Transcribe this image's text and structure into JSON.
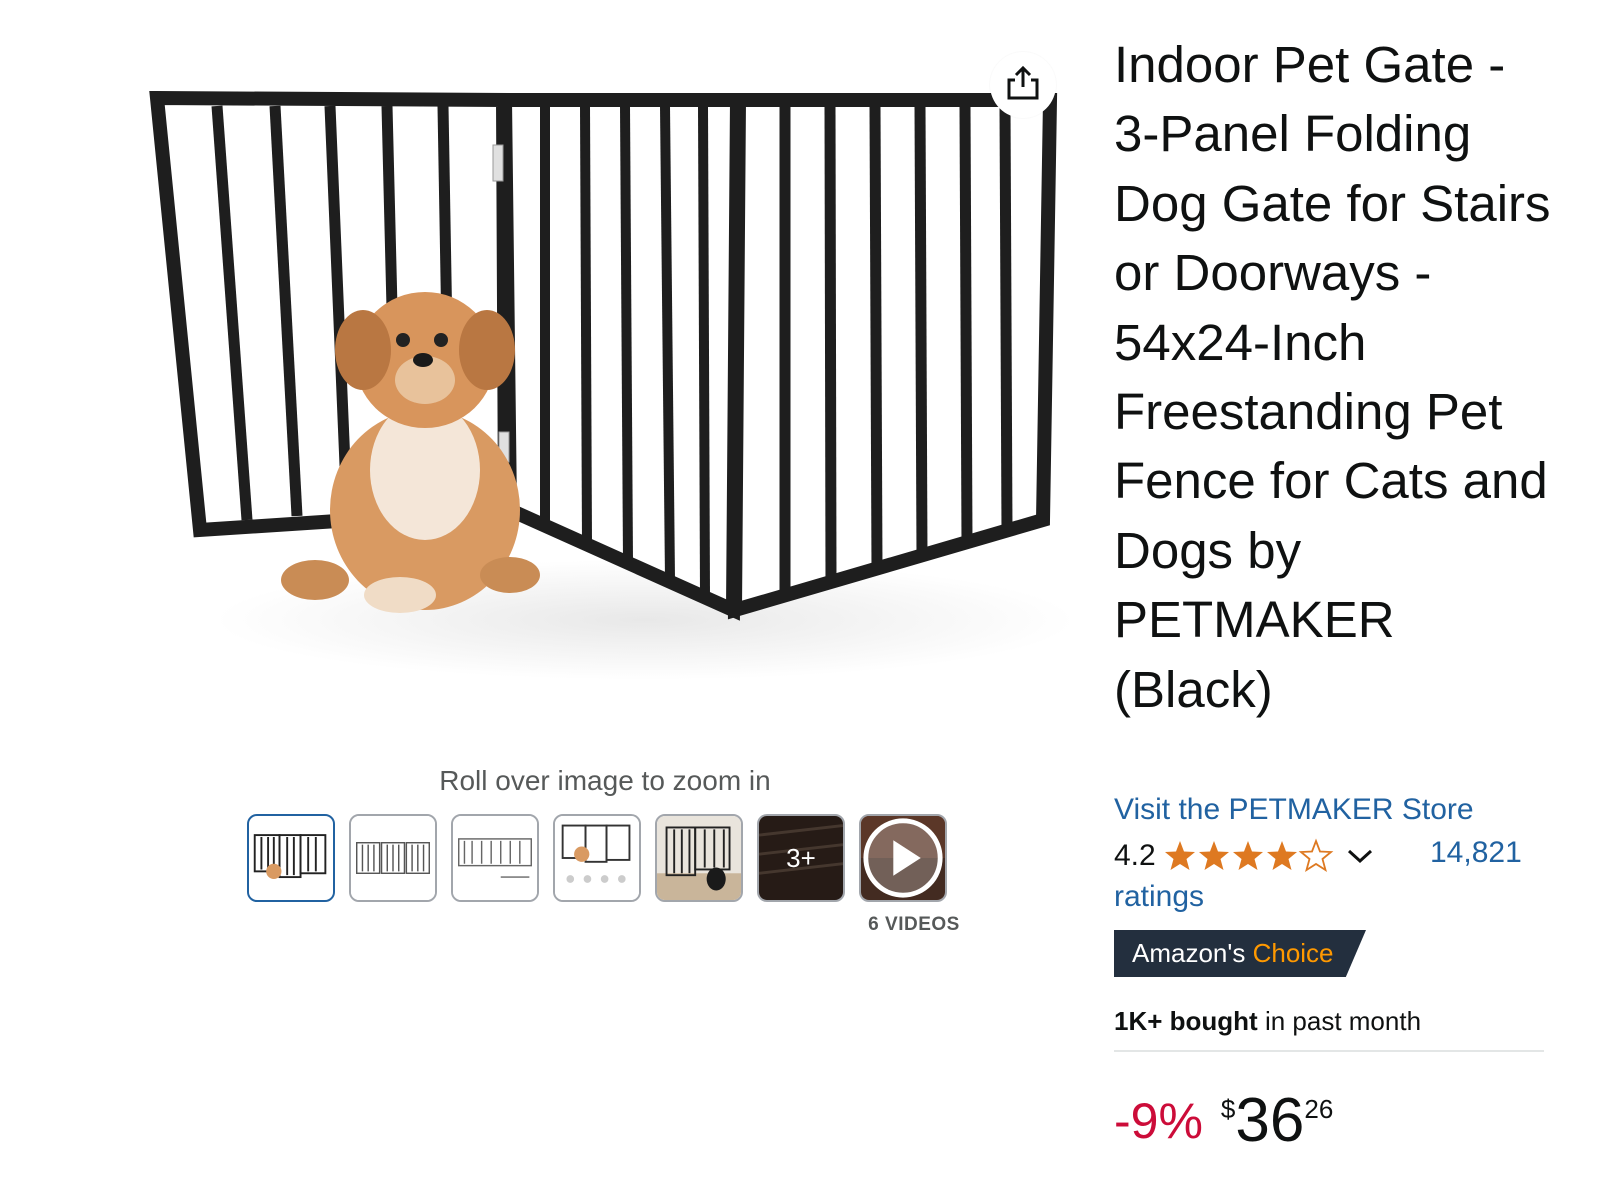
{
  "product": {
    "title": "Indoor Pet Gate - 3-Panel Folding Dog Gate for Stairs or Doorways - 54x24-Inch Freestanding Pet Fence for Cats and Dogs by PETMAKER (Black)",
    "store_link": "Visit the PETMAKER Store",
    "rating": "4.2",
    "rating_stars": 4.2,
    "ratings_count": "14,821",
    "ratings_word": "ratings",
    "badge": {
      "prefix": "Amazon's",
      "highlight": "Choice"
    },
    "bought": {
      "strong": "1K+ bought",
      "rest": " in past month"
    },
    "price": {
      "discount": "-9%",
      "currency": "$",
      "whole": "36",
      "fraction": "26"
    }
  },
  "gallery": {
    "zoom_hint": "Roll over image to zoom in",
    "thumbnails": [
      {
        "kind": "gate-with-dog",
        "selected": true
      },
      {
        "kind": "gate-flat"
      },
      {
        "kind": "gate-dimensions"
      },
      {
        "kind": "gate-features"
      },
      {
        "kind": "room-with-dog"
      },
      {
        "kind": "more",
        "label": "3+"
      },
      {
        "kind": "video"
      }
    ],
    "videos_label": "6 VIDEOS"
  },
  "icons": {
    "share": "share-icon",
    "star": "star-icon",
    "chevron": "chevron-down-icon",
    "play": "play-icon"
  },
  "colors": {
    "link": "#2162a1",
    "star": "#de7921",
    "discount": "#cc0c39",
    "badge_bg": "#232f3e",
    "badge_accent": "#ff9900"
  }
}
